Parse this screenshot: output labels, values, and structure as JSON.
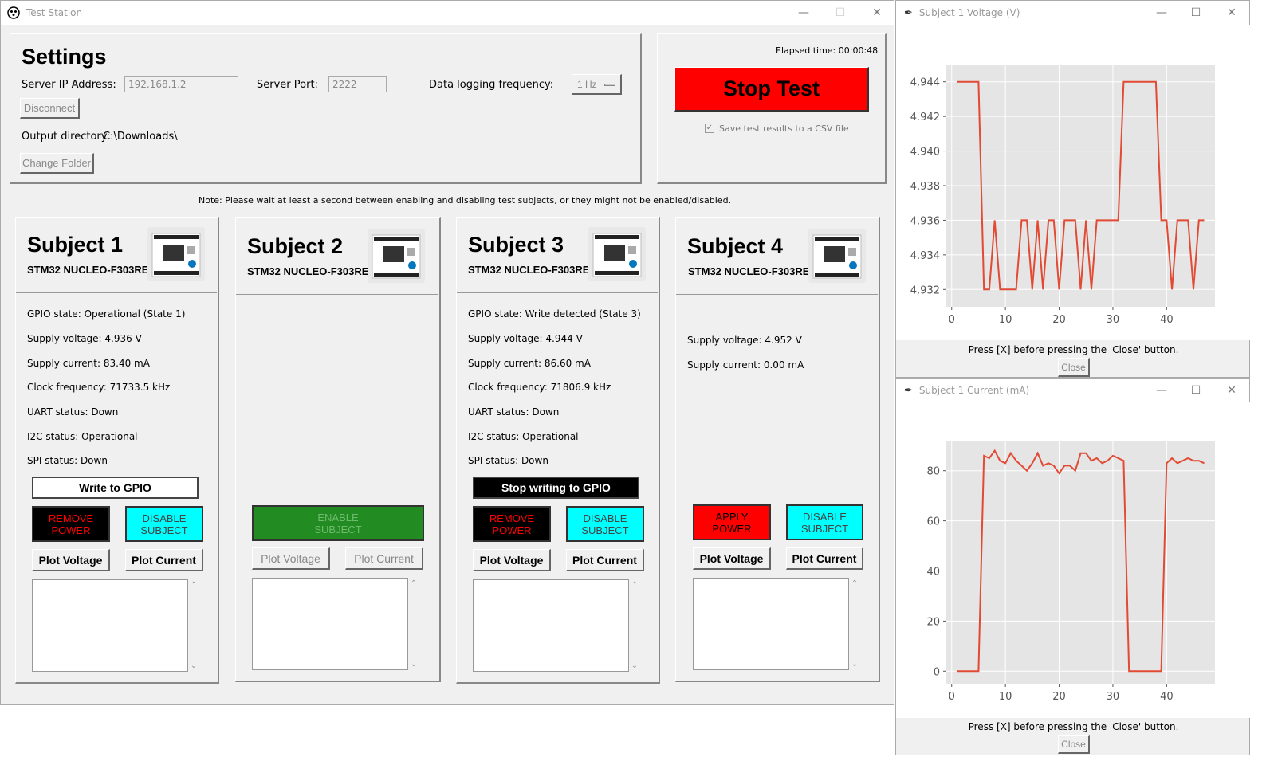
{
  "main_window": {
    "title": "Test Station",
    "settings": {
      "heading": "Settings",
      "server_ip_label": "Server IP Address:",
      "server_ip_value": "192.168.1.2",
      "server_port_label": "Server Port:",
      "server_port_value": "2222",
      "logging_label": "Data logging frequency:",
      "logging_value": "1 Hz",
      "disconnect_label": "Disconnect",
      "output_dir_label": "Output directory:",
      "output_dir_value": "C:\\Downloads\\",
      "change_folder_label": "Change Folder"
    },
    "control": {
      "elapsed": "Elapsed time: 00:00:48",
      "stop_label": "Stop Test",
      "csv_label": "Save test results to a CSV file",
      "csv_checked": true
    },
    "note": "Note: Please wait at least a second between enabling and disabling test subjects, or they might not be enabled/disabled.",
    "subjects": [
      {
        "title": "Subject 1",
        "board": "STM32 NUCLEO-F303RE",
        "gpio": "GPIO state: Operational (State 1)",
        "voltage": "Supply voltage: 4.936 V",
        "current": "Supply current: 83.40 mA",
        "clock": "Clock frequency: 71733.5 kHz",
        "uart": "UART status: Down",
        "i2c": "I2C status: Operational",
        "spi": "SPI status: Down",
        "gpio_btn": "Write to GPIO",
        "power_btn": "REMOVE\nPOWER",
        "power_l1": "REMOVE",
        "power_l2": "POWER",
        "disable_l1": "DISABLE",
        "disable_l2": "SUBJECT",
        "plot_voltage": "Plot Voltage",
        "plot_current": "Plot Current"
      },
      {
        "title": "Subject 2",
        "board": "STM32 NUCLEO-F303RE",
        "enable_l1": "ENABLE",
        "enable_l2": "SUBJECT",
        "plot_voltage": "Plot Voltage",
        "plot_current": "Plot Current"
      },
      {
        "title": "Subject 3",
        "board": "STM32 NUCLEO-F303RE",
        "gpio": "GPIO state: Write detected (State 3)",
        "voltage": "Supply voltage: 4.944 V",
        "current": "Supply current: 86.60 mA",
        "clock": "Clock frequency: 71806.9 kHz",
        "uart": "UART status: Down",
        "i2c": "I2C status: Operational",
        "spi": "SPI status: Down",
        "gpio_btn": "Stop writing to GPIO",
        "power_l1": "REMOVE",
        "power_l2": "POWER",
        "disable_l1": "DISABLE",
        "disable_l2": "SUBJECT",
        "plot_voltage": "Plot Voltage",
        "plot_current": "Plot Current"
      },
      {
        "title": "Subject 4",
        "board": "STM32 NUCLEO-F303RE",
        "voltage": "Supply voltage: 4.952 V",
        "current": "Supply current: 0.00 mA",
        "power_l1": "APPLY",
        "power_l2": "POWER",
        "disable_l1": "DISABLE",
        "disable_l2": "SUBJECT",
        "plot_voltage": "Plot Voltage",
        "plot_current": "Plot Current"
      }
    ],
    "colors": {
      "stop_red": "#ff0000",
      "power_black": "#000000",
      "power_text_red": "#ff0000",
      "cyan": "#00ffff",
      "enable_green": "#228b22",
      "line_red": "#e24a33",
      "plot_bg": "#e5e5e5"
    }
  },
  "voltage_window": {
    "title": "Subject 1 Voltage (V)",
    "note": "Press [X] before pressing the 'Close' button.",
    "close_label": "Close"
  },
  "current_window": {
    "title": "Subject 1 Current (mA)",
    "note": "Press [X] before pressing the 'Close' button.",
    "close_label": "Close"
  },
  "chart_data": [
    {
      "type": "line",
      "title": "",
      "xlabel": "",
      "ylabel": "",
      "xlim": [
        -1,
        49
      ],
      "ylim": [
        4.931,
        4.945
      ],
      "xticks": [
        0,
        10,
        20,
        30,
        40
      ],
      "yticks": [
        4.932,
        4.934,
        4.936,
        4.938,
        4.94,
        4.942,
        4.944
      ],
      "ytick_labels": [
        "4.932",
        "4.934",
        "4.936",
        "4.938",
        "4.940",
        "4.942",
        "4.944"
      ],
      "grid": true,
      "series": [
        {
          "x": [
            1,
            2,
            3,
            4,
            5,
            6,
            7,
            8,
            9,
            10,
            11,
            12,
            13,
            14,
            15,
            16,
            17,
            18,
            19,
            20,
            21,
            22,
            23,
            24,
            25,
            26,
            27,
            28,
            29,
            30,
            31,
            32,
            33,
            34,
            35,
            36,
            37,
            38,
            39,
            40,
            41,
            42,
            43,
            44,
            45,
            46,
            47
          ],
          "values": [
            4.944,
            4.944,
            4.944,
            4.944,
            4.944,
            4.932,
            4.932,
            4.936,
            4.932,
            4.932,
            4.932,
            4.932,
            4.936,
            4.936,
            4.932,
            4.936,
            4.932,
            4.936,
            4.936,
            4.932,
            4.936,
            4.936,
            4.936,
            4.932,
            4.936,
            4.932,
            4.936,
            4.936,
            4.936,
            4.936,
            4.936,
            4.944,
            4.944,
            4.944,
            4.944,
            4.944,
            4.944,
            4.944,
            4.936,
            4.936,
            4.932,
            4.936,
            4.936,
            4.936,
            4.932,
            4.936,
            4.936
          ]
        }
      ]
    },
    {
      "type": "line",
      "title": "",
      "xlabel": "",
      "ylabel": "",
      "xlim": [
        -1,
        49
      ],
      "ylim": [
        -5,
        92
      ],
      "xticks": [
        0,
        10,
        20,
        30,
        40
      ],
      "yticks": [
        0,
        20,
        40,
        60,
        80
      ],
      "ytick_labels": [
        "0",
        "20",
        "40",
        "60",
        "80"
      ],
      "grid": true,
      "series": [
        {
          "x": [
            1,
            2,
            3,
            4,
            5,
            6,
            7,
            8,
            9,
            10,
            11,
            12,
            13,
            14,
            15,
            16,
            17,
            18,
            19,
            20,
            21,
            22,
            23,
            24,
            25,
            26,
            27,
            28,
            29,
            30,
            31,
            32,
            33,
            34,
            35,
            36,
            37,
            38,
            39,
            40,
            41,
            42,
            43,
            44,
            45,
            46,
            47
          ],
          "values": [
            0,
            0,
            0,
            0,
            0,
            86,
            85,
            88,
            84,
            83,
            87,
            84,
            82,
            80,
            83,
            87,
            82,
            83,
            82,
            79,
            82,
            82,
            80,
            87,
            87,
            84,
            85,
            83,
            84,
            86,
            85,
            84,
            0,
            0,
            0,
            0,
            0,
            0,
            0,
            83,
            85,
            83,
            84,
            85,
            84,
            84,
            83
          ]
        }
      ]
    }
  ]
}
